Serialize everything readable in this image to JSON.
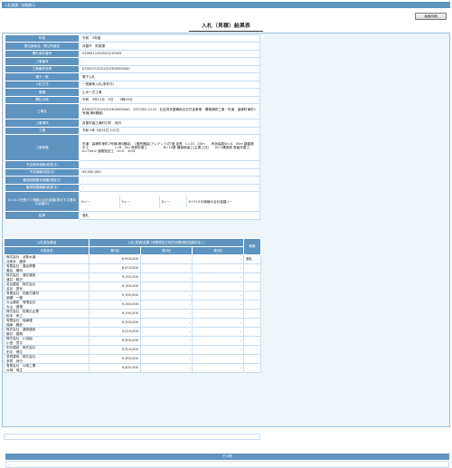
{
  "window": {
    "title": "入札経過／詳細表示"
  },
  "toolbar": {
    "print_label": "画面印刷"
  },
  "page": {
    "title": "入札（見積）結果表"
  },
  "info": {
    "fiscal_year": {
      "label": "年度",
      "value": "令和　3年度"
    },
    "orderer": {
      "label": "発注部局名／発注所属名",
      "value": "弁蘭市　財政課"
    },
    "bid_number": {
      "label": "開札案件番号",
      "value": "0309011032020210055"
    },
    "work_number": {
      "label": "工事番号",
      "value": "-"
    },
    "work_number_name": {
      "label": "工事番号名称",
      "value": "K3320712021010300000040"
    },
    "electronic": {
      "label": "電子／紙",
      "value": "電子入札"
    },
    "method": {
      "label": "入札方式",
      "value": "一般競争入札(条件付)"
    },
    "category": {
      "label": "業種",
      "value": "土木一式工事"
    },
    "open_date": {
      "label": "開札日時",
      "value": "令和　3年12月　9日　　9時00分"
    },
    "work_name": {
      "label": "工事名",
      "value": "K3320712021010300000040　2GT-R02-1214　社会資本整備総合交付金事業　構築補修工事／市道　高峰町東町2号線(第8舗道)"
    },
    "location": {
      "label": "工事場所",
      "value": "弁蘭市高江東町中町　地内"
    },
    "period": {
      "label": "工期",
      "value": "令和 4年 3月31日 112日"
    },
    "overview": {
      "label": "工事概要",
      "value": "市道　高峰町東町2号線(第8舗装)　1箇所舗装(アレテンド)打施 延長　L=15．20ｍ　　有効幅員W=4．00ｍ 路盤路平工　　　　　　　　L=6．0ｍ 浸食防護工　　　　　N=10基 舗道面保工(主要工法)　　N=1構造物 表面改善工　　　　　　A=75ｍ2 道路復旧工　A=0．1ｍ3"
    },
    "planned_price_after": {
      "label": "予定価本価格(税抜き)",
      "value": "-"
    },
    "planned_price": {
      "label": "予定価格(税抜き)",
      "value": "¥9,540,000-"
    },
    "min_limit_after": {
      "label": "最低制限基本価格(税抜き)",
      "value": "-"
    },
    "min_limit": {
      "label": "最低制限価格(税抜き)",
      "value": "-"
    },
    "coefficients": {
      "label": "A.V.Z.Uを受けて価格の合計金額(算出する基本の金額示)",
      "x": "X＝－",
      "y": "Y＝－",
      "z": "Z＝－",
      "total": "X+Y+Zの価格の合計金額＝－"
    },
    "result": {
      "label": "結果",
      "value": "落札"
    }
  },
  "bids": {
    "header_bidder": "入札参加業者",
    "header_rep": "代表者名",
    "header_amount": "入札(見積)結果 (消費税及び地方消費税相当額を除く)",
    "header_round1": "第1回",
    "header_round2": "第2回",
    "header_round3": "第3回",
    "header_note": "摘要",
    "rows": [
      {
        "bidder": "株式会社　北条水道\n北条永　勝彦",
        "r1": "8,950,000",
        "r2": "-",
        "r3": "-",
        "note": "落札"
      },
      {
        "bidder": "有限会社　春谷興業\n春谷　陽司",
        "r1": "8,970,000",
        "r2": "-",
        "r3": "-",
        "note": ""
      },
      {
        "bidder": "株式会社　渡井建設\n渡井　聡史",
        "r1": "9,150,000",
        "r2": "-",
        "r3": "-",
        "note": ""
      },
      {
        "bidder": "名谷建設　株式会社\n名谷　慶司",
        "r1": "9,150,000",
        "r2": "-",
        "r3": "-",
        "note": ""
      },
      {
        "bidder": "有限会社　田面兀建材\n畑瀬　一樹",
        "r1": "9,150,000",
        "r2": "-",
        "r3": "-",
        "note": ""
      },
      {
        "bidder": "大山建設　有限会社\n大山　優博",
        "r1": "9,180,000",
        "r2": "-",
        "r3": "-",
        "note": ""
      },
      {
        "bidder": "株式会社　松尾出山業\n松本　孝之",
        "r1": "9,190,000",
        "r2": "-",
        "r3": "-",
        "note": ""
      },
      {
        "bidder": "有限会社　瑞津建\n瑞津　勝彦",
        "r1": "9,200,000",
        "r2": "-",
        "r3": "-",
        "note": ""
      },
      {
        "bidder": "株式会社　薬師建設\n藤井　善典",
        "r1": "9,210,000",
        "r2": "-",
        "r3": "-",
        "note": ""
      },
      {
        "bidder": "株式会社　小田組\n小田　寛平",
        "r1": "9,300,000",
        "r2": "-",
        "r3": "-",
        "note": ""
      },
      {
        "bidder": "田中建設　株式会社\n田中　博生",
        "r1": "9,310,000",
        "r2": "-",
        "r3": "-",
        "note": ""
      },
      {
        "bidder": "多賀建設　株式会社\n多賀　尚行",
        "r1": "9,350,000",
        "r2": "-",
        "r3": "-",
        "note": ""
      },
      {
        "bidder": "有限会社　片岡工業\n片岡　瑞生",
        "r1": "9,400,000",
        "r2": "-",
        "r3": "-",
        "note": ""
      }
    ],
    "blank_value": "-"
  },
  "other": {
    "label": "その他",
    "value": "-"
  },
  "colors": {
    "header_bg": "#5f93c0",
    "panel_bg": "#eef6fc",
    "border": "#c9dced"
  }
}
